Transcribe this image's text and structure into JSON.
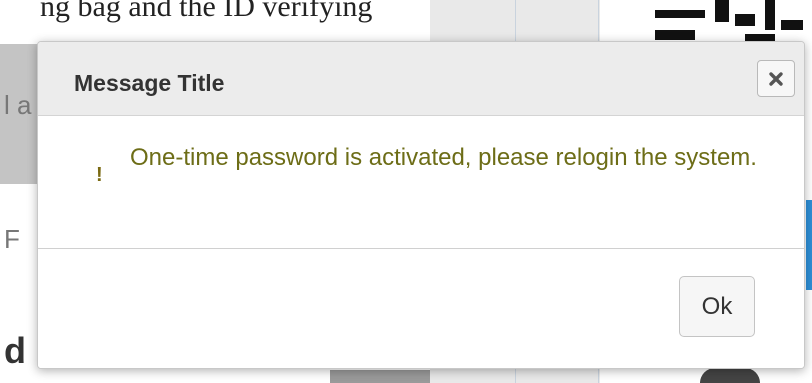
{
  "background": {
    "top_text": "ng bag and the ID verifying",
    "left_text_1": "l a",
    "left_text_2": "F",
    "left_text_3": "d"
  },
  "dialog": {
    "title": "Message Title",
    "close_icon": "close-icon",
    "message_icon": "warning-icon",
    "message_icon_glyph": "!",
    "message": "One-time password is activated, please relogin the system.",
    "ok_label": "Ok"
  },
  "colors": {
    "message_text": "#6d6d17",
    "header_bg": "#ececec",
    "accent_blue": "#2d8ed6"
  }
}
